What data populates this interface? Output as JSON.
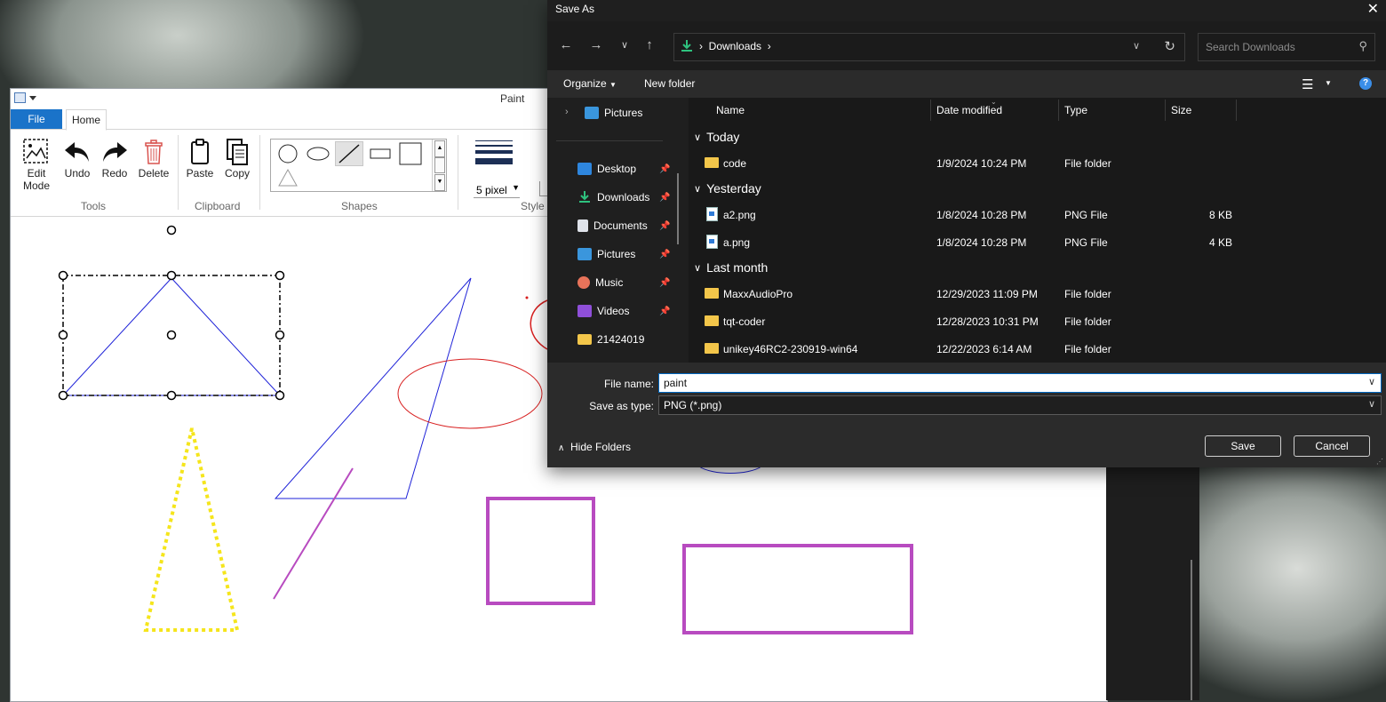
{
  "paint": {
    "title": "Paint",
    "tabs": {
      "file": "File",
      "home": "Home"
    },
    "tools": {
      "edit_mode": "Edit\nMode",
      "undo": "Undo",
      "redo": "Redo",
      "delete": "Delete"
    },
    "clipboard": {
      "paste": "Paste",
      "copy": "Copy"
    },
    "groups": {
      "tools": "Tools",
      "clipboard": "Clipboard",
      "shapes": "Shapes",
      "style": "Style"
    },
    "style": {
      "thickness": "5 pixel"
    },
    "colors": {
      "selection": "#000000",
      "triangle": "#1e22d8",
      "ellipse": "#d81e1e",
      "yellow": "#f5e51b",
      "magenta": "#b84bc0"
    }
  },
  "dialog": {
    "title": "Save As",
    "close": "✕",
    "address": {
      "crumb": "Downloads"
    },
    "search": {
      "placeholder": "Search Downloads"
    },
    "commands": {
      "organize": "Organize",
      "new_folder": "New folder"
    },
    "nav": {
      "top_item": "Pictures",
      "items": [
        {
          "label": "Desktop",
          "pinned": true
        },
        {
          "label": "Downloads",
          "pinned": true
        },
        {
          "label": "Documents",
          "pinned": true
        },
        {
          "label": "Pictures",
          "pinned": true
        },
        {
          "label": "Music",
          "pinned": true
        },
        {
          "label": "Videos",
          "pinned": true
        },
        {
          "label": "21424019",
          "pinned": false
        }
      ]
    },
    "columns": {
      "name": "Name",
      "date": "Date modified",
      "type": "Type",
      "size": "Size"
    },
    "groups": {
      "today": "Today",
      "yesterday": "Yesterday",
      "last_month": "Last month"
    },
    "files": [
      {
        "name": "code",
        "date": "1/9/2024 10:24 PM",
        "type": "File folder",
        "size": ""
      },
      {
        "name": "a2.png",
        "date": "1/8/2024 10:28 PM",
        "type": "PNG File",
        "size": "8 KB"
      },
      {
        "name": "a.png",
        "date": "1/8/2024 10:28 PM",
        "type": "PNG File",
        "size": "4 KB"
      },
      {
        "name": "MaxxAudioPro",
        "date": "12/29/2023 11:09 PM",
        "type": "File folder",
        "size": ""
      },
      {
        "name": "tqt-coder",
        "date": "12/28/2023 10:31 PM",
        "type": "File folder",
        "size": ""
      },
      {
        "name": "unikey46RC2-230919-win64",
        "date": "12/22/2023 6:14 AM",
        "type": "File folder",
        "size": ""
      }
    ],
    "file_name": {
      "label": "File name:",
      "value": "paint"
    },
    "save_type": {
      "label": "Save as type:",
      "value": "PNG (*.png)"
    },
    "hide_folders": "Hide Folders",
    "save": "Save",
    "cancel": "Cancel"
  }
}
